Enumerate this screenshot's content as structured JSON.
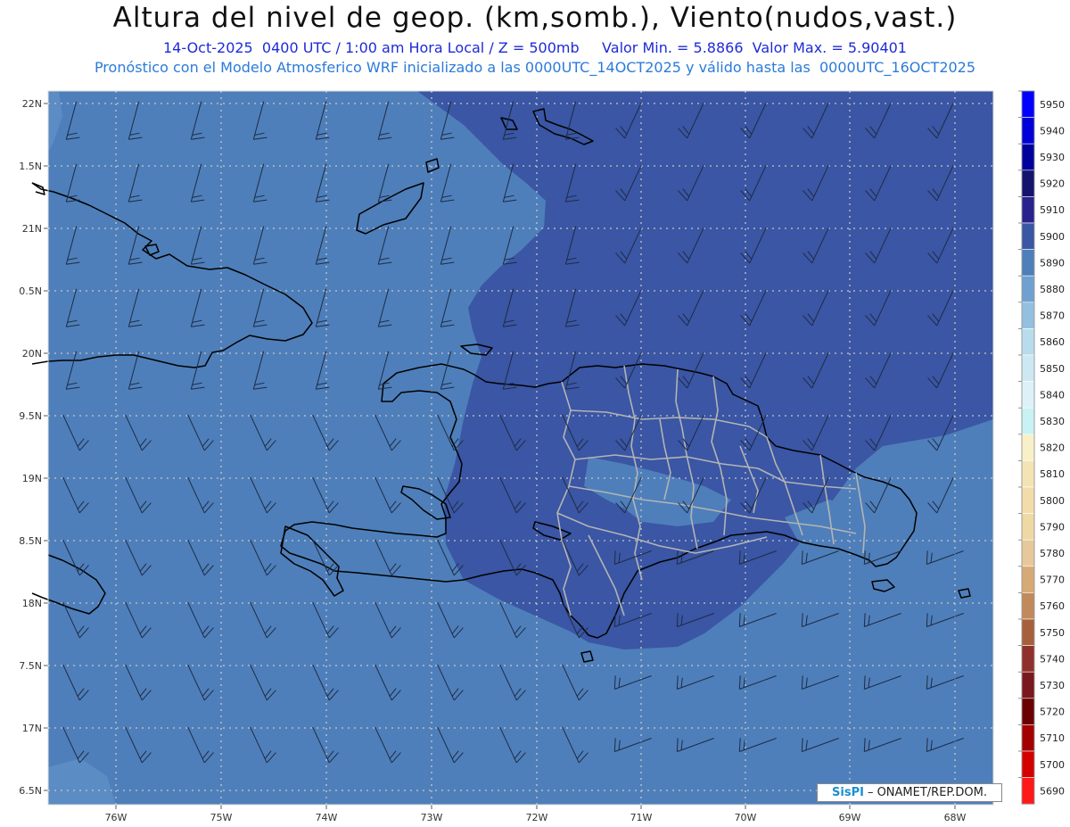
{
  "title": "Altura del nivel de geop. (km,somb.), Viento(nudos,vast.)",
  "subtitle_line1": "14-Oct-2025  0400 UTC / 1:00 am Hora Local / Z = 500mb     Valor Min. = 5.8866  Valor Max. = 5.90401",
  "subtitle_line2": "Pronóstico con el Modelo Atmosferico WRF inicializado a las 0000UTC_14OCT2025 y válido hasta las  0000UTC_16OCT2025",
  "credit": {
    "brand": "SisPI",
    "text": "– ONAMET/REP.DOM."
  },
  "map": {
    "lat_labels": [
      "22N",
      "1.5N",
      "21N",
      "0.5N",
      "20N",
      "9.5N",
      "19N",
      "8.5N",
      "18N",
      "7.5N",
      "17N",
      "6.5N"
    ],
    "lon_labels": [
      "76W",
      "75W",
      "74W",
      "73W",
      "72W",
      "71W",
      "70W",
      "69W",
      "68W"
    ],
    "colors": {
      "field_low": "#4e7fba",
      "field_high": "#3a56a4",
      "field_mid": "#5b8cc3",
      "coast": "#000000",
      "borders": "#b4b4b4",
      "grid": "#c8c8c8"
    }
  },
  "colorbar": {
    "levels": [
      "5950",
      "5940",
      "5930",
      "5920",
      "5910",
      "5900",
      "5890",
      "5880",
      "5870",
      "5860",
      "5850",
      "5840",
      "5830",
      "5820",
      "5810",
      "5800",
      "5790",
      "5780",
      "5770",
      "5760",
      "5750",
      "5740",
      "5730",
      "5720",
      "5710",
      "5700",
      "5690"
    ],
    "colors": [
      "#0000ff",
      "#0000d8",
      "#00009c",
      "#14146e",
      "#28238c",
      "#3a56a4",
      "#4e7fba",
      "#6fa0cf",
      "#93c0df",
      "#b9dcec",
      "#cde8f2",
      "#ddf2f8",
      "#c8f2f4",
      "#f8f0c8",
      "#f4e4b4",
      "#f2dcaa",
      "#eed8a4",
      "#e6c89a",
      "#d6aa76",
      "#c18a5a",
      "#a8603c",
      "#90302c",
      "#7a1820",
      "#6a0000",
      "#a40000",
      "#d40000",
      "#ff1818"
    ]
  }
}
